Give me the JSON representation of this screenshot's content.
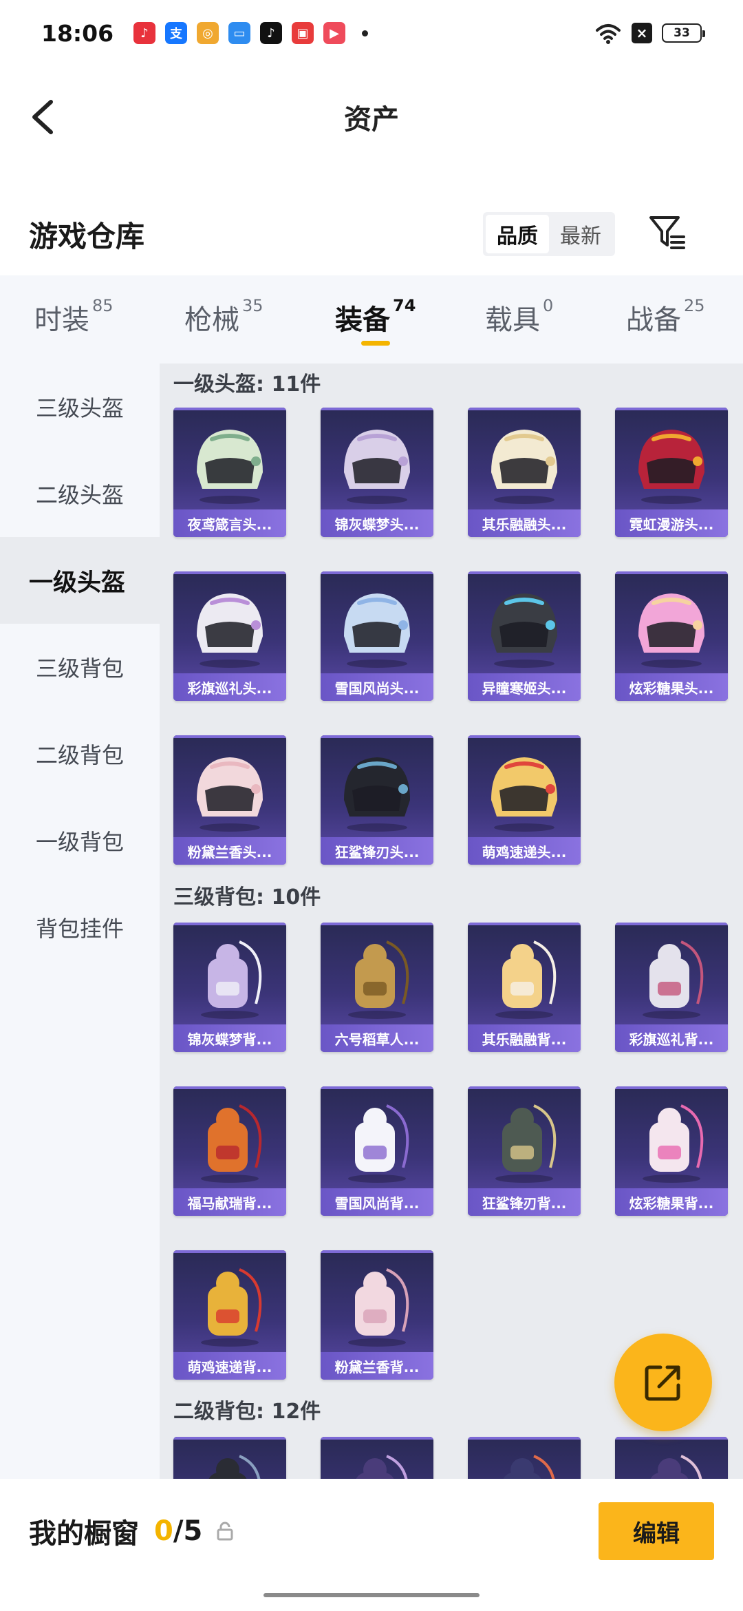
{
  "status_bar": {
    "time": "18:06",
    "battery": "33",
    "app_icons": [
      {
        "name": "music-app-icon",
        "glyph": "♪",
        "color": "#e8323c"
      },
      {
        "name": "alipay-app-icon",
        "glyph": "支",
        "color": "#1677ff"
      },
      {
        "name": "coin-app-icon",
        "glyph": "◎",
        "color": "#f0a830"
      },
      {
        "name": "folder-app-icon",
        "glyph": "▭",
        "color": "#2e8cf0"
      },
      {
        "name": "tiktok-app-icon",
        "glyph": "♪",
        "color": "#111111"
      },
      {
        "name": "shop-app-icon",
        "glyph": "▣",
        "color": "#e83b3b"
      },
      {
        "name": "video-app-icon",
        "glyph": "▶",
        "color": "#ef4b5b"
      }
    ]
  },
  "header": {
    "title": "资产"
  },
  "warehouse": {
    "title": "游戏仓库",
    "sort_quality": "品质",
    "sort_latest": "最新"
  },
  "tabs": [
    {
      "label": "时装",
      "count": "85"
    },
    {
      "label": "枪械",
      "count": "35"
    },
    {
      "label": "装备",
      "count": "74"
    },
    {
      "label": "载具",
      "count": "0"
    },
    {
      "label": "战备",
      "count": "25"
    }
  ],
  "sidebar": [
    {
      "label": "三级头盔"
    },
    {
      "label": "二级头盔"
    },
    {
      "label": "一级头盔"
    },
    {
      "label": "三级背包"
    },
    {
      "label": "二级背包"
    },
    {
      "label": "一级背包"
    },
    {
      "label": "背包挂件"
    }
  ],
  "sections": [
    {
      "title": "一级头盔: 11件",
      "items": [
        {
          "label": "夜鸢箴言头...",
          "color": "#d8e8d0",
          "accent": "#7fae8c"
        },
        {
          "label": "锦灰蝶梦头...",
          "color": "#d9cfe8",
          "accent": "#b8a2d6"
        },
        {
          "label": "其乐融融头...",
          "color": "#f3ead2",
          "accent": "#e2c98f"
        },
        {
          "label": "霓虹漫游头...",
          "color": "#b8233a",
          "accent": "#f0a830"
        },
        {
          "label": "彩旗巡礼头...",
          "color": "#eceaf2",
          "accent": "#b98fd8"
        },
        {
          "label": "雪国风尚头...",
          "color": "#c7daf2",
          "accent": "#8fb4e6"
        },
        {
          "label": "异瞳寒姬头...",
          "color": "#3a3d44",
          "accent": "#5cc6e8"
        },
        {
          "label": "炫彩糖果头...",
          "color": "#f2a6d8",
          "accent": "#f6d3a0"
        },
        {
          "label": "粉黛兰香头...",
          "color": "#f2d8dc",
          "accent": "#e9b8c0"
        },
        {
          "label": "狂鲨锋刃头...",
          "color": "#24262e",
          "accent": "#6aa6c8"
        },
        {
          "label": "萌鸡速递头...",
          "color": "#f2c96a",
          "accent": "#e0463c"
        }
      ]
    },
    {
      "title": "三级背包: 10件",
      "items": [
        {
          "label": "锦灰蝶梦背...",
          "color": "#c7b5e6",
          "accent": "#f0f0f8"
        },
        {
          "label": "六号稻草人...",
          "color": "#c39a4e",
          "accent": "#7a5a24"
        },
        {
          "label": "其乐融融背...",
          "color": "#f4d28a",
          "accent": "#f6f0e6"
        },
        {
          "label": "彩旗巡礼背...",
          "color": "#e4e2ec",
          "accent": "#c4567c"
        },
        {
          "label": "福马献瑞背...",
          "color": "#e0722c",
          "accent": "#b8282e"
        },
        {
          "label": "雪国风尚背...",
          "color": "#f4f4fa",
          "accent": "#8a6ad0"
        },
        {
          "label": "狂鲨锋刃背...",
          "color": "#4e5a52",
          "accent": "#d8c68a"
        },
        {
          "label": "炫彩糖果背...",
          "color": "#f4e6ee",
          "accent": "#e86ab0"
        },
        {
          "label": "萌鸡速递背...",
          "color": "#e8b23a",
          "accent": "#d83a30"
        },
        {
          "label": "粉黛兰香背...",
          "color": "#f2d8e0",
          "accent": "#d8a2b8"
        }
      ]
    },
    {
      "title": "二级背包: 12件",
      "items": [
        {
          "label": "",
          "color": "#2a2c34",
          "accent": "#8aa0c0"
        },
        {
          "label": "",
          "color": "#4a3c7a",
          "accent": "#c0a0e0"
        },
        {
          "label": "",
          "color": "#3a3a70",
          "accent": "#e06a4a"
        },
        {
          "label": "",
          "color": "#4a3c7a",
          "accent": "#e0c0d8"
        }
      ]
    }
  ],
  "showcase": {
    "title": "我的橱窗",
    "current": "0",
    "total": "/5",
    "edit_label": "编辑"
  }
}
